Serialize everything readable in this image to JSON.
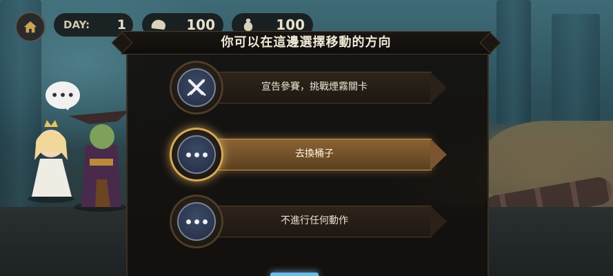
{
  "hud": {
    "day_label": "DAY:",
    "day_value": "1",
    "food_value": "100",
    "gold_value": "100",
    "icons": {
      "home": "home-icon",
      "food": "bread-icon",
      "gold": "money-bag-icon"
    }
  },
  "speech_icon": "ellipsis-speech-bubble-icon",
  "dialog": {
    "title": "你可以在這邊選擇移動的方向",
    "options": [
      {
        "label": "宣告參賽，挑戰煙霧關卡",
        "icon": "crossed-swords-icon",
        "selected": false
      },
      {
        "label": "去換桶子",
        "icon": "ellipsis-icon",
        "selected": true
      },
      {
        "label": "不進行任何動作",
        "icon": "ellipsis-icon",
        "selected": false
      }
    ]
  },
  "colors": {
    "selected_accent": "#d8a95a",
    "dialog_bg": "#120f0d",
    "option_icon_bg": "#2e3a55"
  }
}
